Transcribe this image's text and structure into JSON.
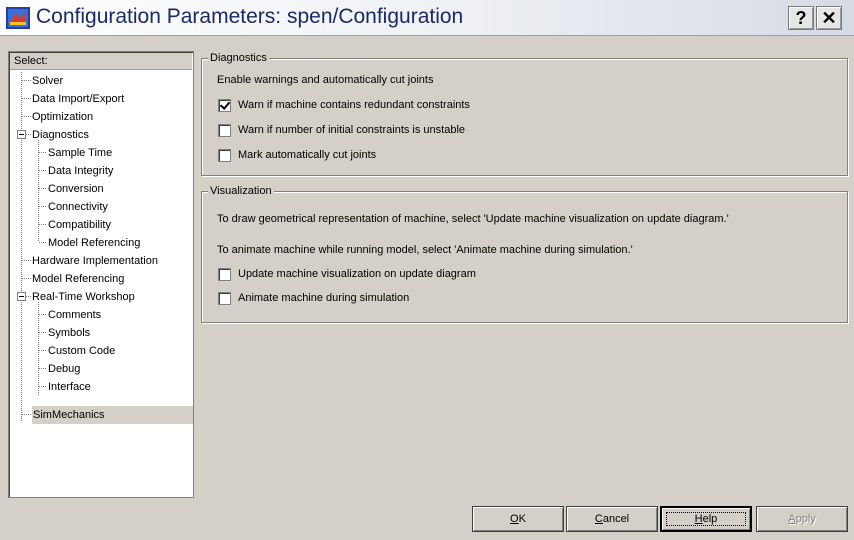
{
  "window": {
    "title": "Configuration Parameters: spen/Configuration",
    "help_glyph": "?",
    "close_glyph": "✕",
    "icon": "simulink-model-icon"
  },
  "tree": {
    "header": "Select:",
    "items": [
      {
        "label": "Solver",
        "level": 1
      },
      {
        "label": "Data Import/Export",
        "level": 1
      },
      {
        "label": "Optimization",
        "level": 1
      },
      {
        "label": "Diagnostics",
        "level": 1,
        "expanded": true
      },
      {
        "label": "Sample Time",
        "level": 2
      },
      {
        "label": "Data Integrity",
        "level": 2
      },
      {
        "label": "Conversion",
        "level": 2
      },
      {
        "label": "Connectivity",
        "level": 2
      },
      {
        "label": "Compatibility",
        "level": 2
      },
      {
        "label": "Model Referencing",
        "level": 2
      },
      {
        "label": "Hardware Implementation",
        "level": 1
      },
      {
        "label": "Model Referencing",
        "level": 1
      },
      {
        "label": "Real-Time Workshop",
        "level": 1,
        "expanded": true
      },
      {
        "label": "Comments",
        "level": 2
      },
      {
        "label": "Symbols",
        "level": 2
      },
      {
        "label": "Custom Code",
        "level": 2
      },
      {
        "label": "Debug",
        "level": 2
      },
      {
        "label": "Interface",
        "level": 2
      },
      {
        "label": "SimMechanics",
        "level": 1,
        "selected": true
      }
    ]
  },
  "diagnostics": {
    "title": "Diagnostics",
    "intro": "Enable warnings and automatically cut joints",
    "options": [
      {
        "label": "Warn if machine contains redundant constraints",
        "checked": true
      },
      {
        "label": "Warn if number of initial constraints is unstable",
        "checked": false
      },
      {
        "label": "Mark automatically cut joints",
        "checked": false
      }
    ]
  },
  "visualization": {
    "title": "Visualization",
    "line1": "To draw geometrical representation of machine, select 'Update machine visualization on update diagram.'",
    "line2": "To animate machine while running model, select 'Animate machine during simulation.'",
    "options": [
      {
        "label": "Update machine visualization on update diagram",
        "checked": false
      },
      {
        "label": "Animate machine during simulation",
        "checked": false
      }
    ]
  },
  "buttons": {
    "ok": {
      "mnemonic": "O",
      "rest": "K"
    },
    "cancel": {
      "mnemonic": "C",
      "rest": "ancel"
    },
    "help": {
      "mnemonic": "H",
      "rest": "elp"
    },
    "apply": {
      "mnemonic": "A",
      "rest": "pply"
    }
  }
}
